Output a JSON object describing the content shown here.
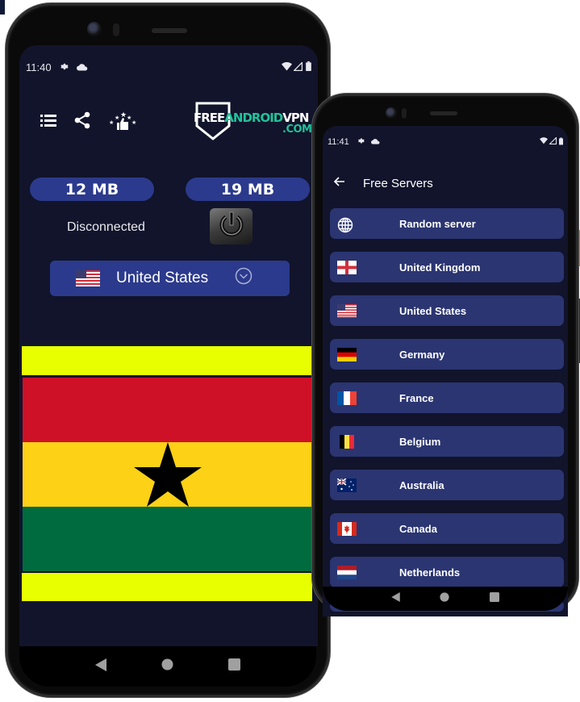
{
  "left_phone": {
    "status_bar": {
      "time": "11:40",
      "left_icons": [
        "settings-icon",
        "cloud-icon"
      ],
      "right_icons": [
        "wifi-icon",
        "signal-icon",
        "battery-icon"
      ]
    },
    "toolbar": {
      "icons": [
        "menu-list-icon",
        "share-icon",
        "rate-stars-thumbs-up-icon"
      ]
    },
    "logo": {
      "part1": "FREE",
      "part2": "ANDROID",
      "part3": "VPN",
      "part4": ".COM",
      "accent_color": "#22c29a"
    },
    "download_label": "12 MB",
    "upload_label": "19 MB",
    "connection_status": "Disconnected",
    "power_button": "power-icon",
    "selected_country": {
      "name": "United States",
      "flag": "us-flag-icon"
    },
    "displayed_flag": {
      "country": "Ghana",
      "colors": {
        "outer_band": "#e8ff00",
        "red": "#ce1126",
        "gold": "#fcd116",
        "green": "#006b3f",
        "star": "#000000"
      }
    },
    "nav_bar": [
      "back-icon",
      "home-icon",
      "recents-icon"
    ]
  },
  "right_phone": {
    "status_bar": {
      "time": "11:41",
      "left_icons": [
        "settings-icon",
        "cloud-icon"
      ],
      "right_icons": [
        "wifi-icon",
        "signal-icon",
        "battery-icon"
      ]
    },
    "header": {
      "back_icon": "arrow-left-icon",
      "title": "Free Servers"
    },
    "servers": [
      {
        "name": "Random server",
        "icon": "globe-icon"
      },
      {
        "name": "United Kingdom",
        "icon": "uk-flag-icon"
      },
      {
        "name": "United States",
        "icon": "us-flag-icon"
      },
      {
        "name": "Germany",
        "icon": "de-flag-icon"
      },
      {
        "name": "France",
        "icon": "fr-flag-icon"
      },
      {
        "name": "Belgium",
        "icon": "be-flag-icon"
      },
      {
        "name": "Australia",
        "icon": "au-flag-icon"
      },
      {
        "name": "Canada",
        "icon": "ca-flag-icon"
      },
      {
        "name": "Netherlands",
        "icon": "nl-flag-icon"
      }
    ],
    "nav_bar": [
      "back-icon",
      "home-icon",
      "recents-icon"
    ]
  },
  "theme": {
    "background": "#11142b",
    "card": "#2b3572",
    "pill": "#2b3a8c",
    "text": "#ffffff"
  }
}
